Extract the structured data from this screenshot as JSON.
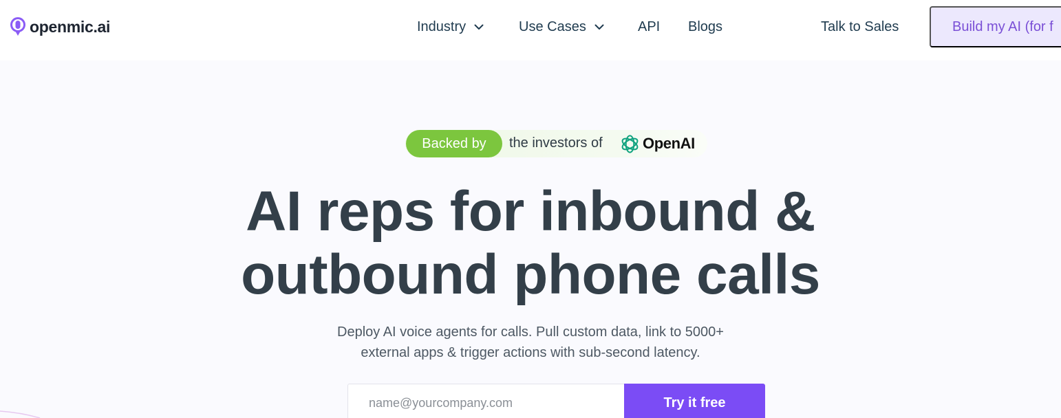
{
  "brand": {
    "name": "openmic.ai",
    "accent": "#7b4cf5",
    "logo_icon": "microphone-pin-icon"
  },
  "nav": {
    "items": [
      {
        "label": "Industry",
        "has_dropdown": true
      },
      {
        "label": "Use Cases",
        "has_dropdown": true
      },
      {
        "label": "API",
        "has_dropdown": false
      },
      {
        "label": "Blogs",
        "has_dropdown": false
      }
    ],
    "talk_to_sales": "Talk to Sales",
    "build_button": "Build my AI (for f"
  },
  "badge": {
    "pill": "Backed by",
    "text": "the investors of",
    "company": "OpenAI",
    "pill_color": "#7cc63e"
  },
  "hero": {
    "headline_line1": "AI reps for inbound &",
    "headline_line2": "outbound phone calls",
    "subtext_line1": "Deploy AI voice agents for calls. Pull custom data, link to 5000+",
    "subtext_line2": "external apps & trigger actions with sub-second latency."
  },
  "signup": {
    "email_placeholder": "name@yourcompany.com",
    "email_value": "",
    "cta": "Try it free"
  }
}
